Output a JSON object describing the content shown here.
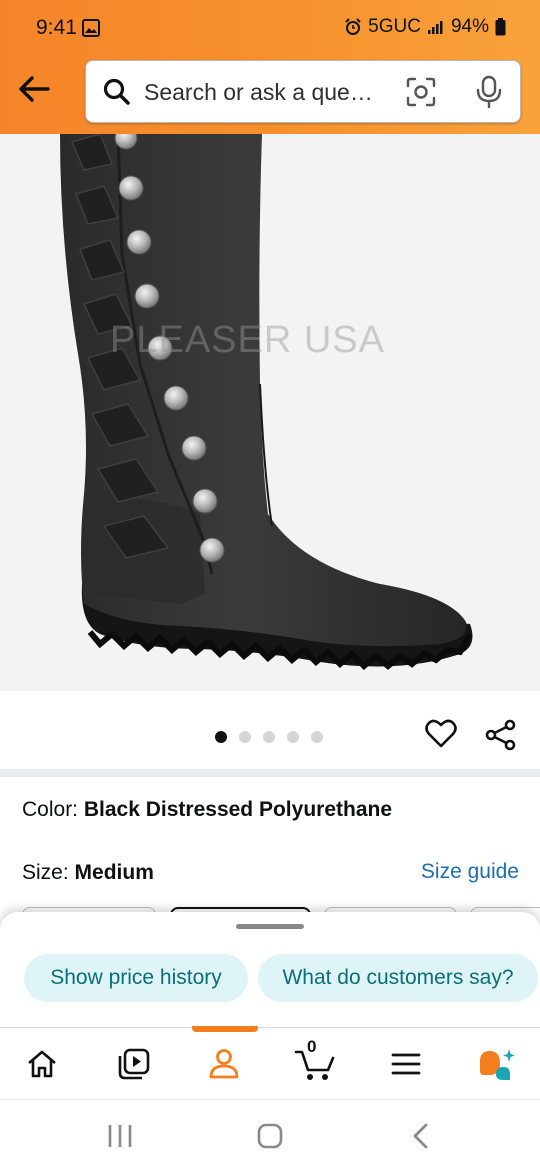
{
  "status_bar": {
    "time": "9:41",
    "network": "5GUC",
    "battery": "94%",
    "icons": [
      "photo-icon",
      "alarm-icon",
      "signal-icon",
      "battery-icon"
    ]
  },
  "search": {
    "placeholder": "Search or ask a que…"
  },
  "product": {
    "image_name": "black-knee-high-boot",
    "watermark": "PLEASER USA",
    "image_count": 5,
    "active_image": 1
  },
  "variation": {
    "color_key": "Color:",
    "color_value": "Black Distressed Polyurethane",
    "size_key": "Size:",
    "size_value": "Medium",
    "size_guide": "Size guide"
  },
  "bottom_sheet": {
    "chips": [
      "Show price history",
      "What do customers say?"
    ]
  },
  "tab_bar": {
    "tabs": [
      "home-icon",
      "video-icon",
      "account-icon",
      "cart-icon",
      "menu-icon",
      "rufus-icon"
    ],
    "active_tab": "account-icon",
    "cart_count": "0"
  },
  "colors": {
    "header": "#f7902c",
    "accent": "#f57e1f",
    "link": "#1f6db0",
    "chip_bg": "#dff4f6",
    "chip_text": "#0b6e79"
  }
}
